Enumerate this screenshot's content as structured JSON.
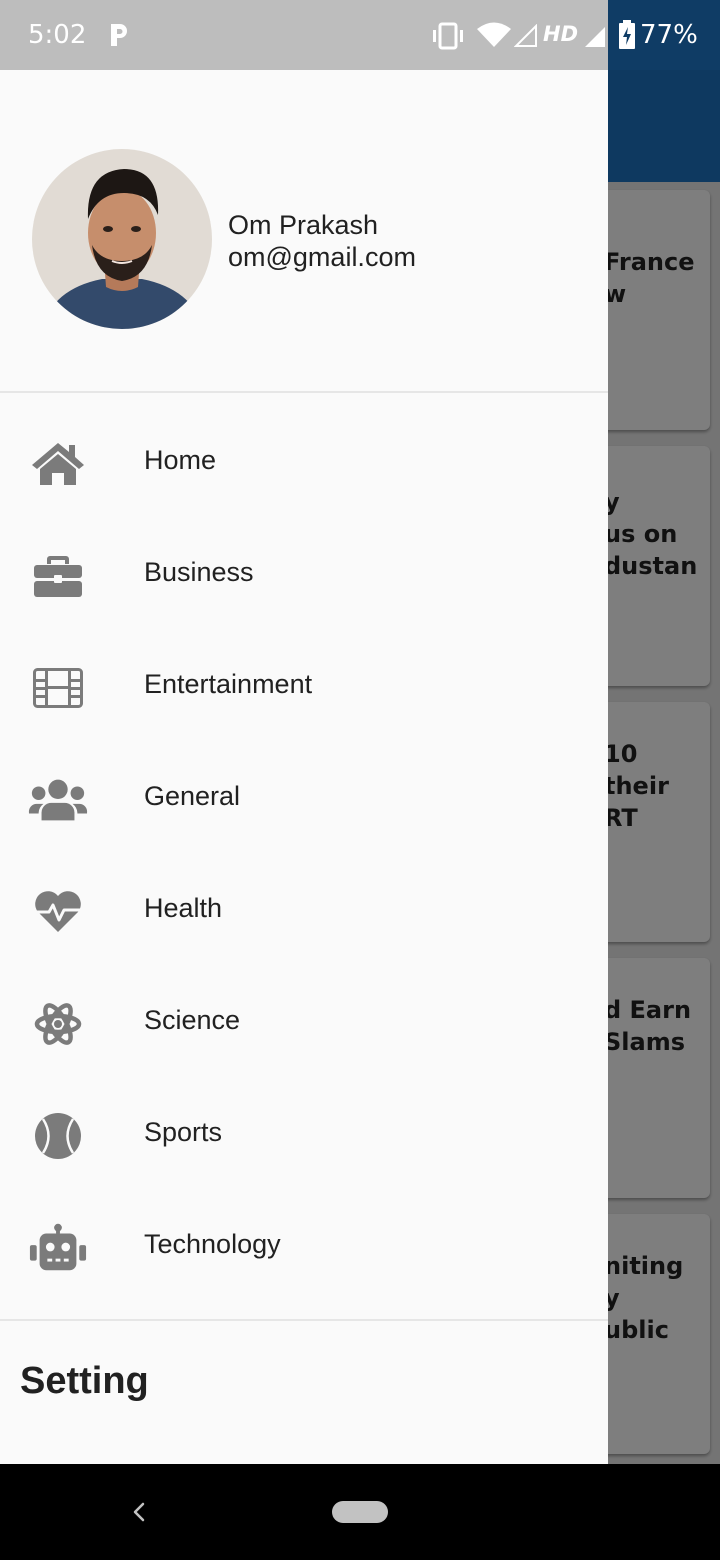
{
  "status_bar": {
    "time": "5:02",
    "network": "HD",
    "battery": "77%"
  },
  "background": {
    "cards": [
      {
        "text": "France\nw"
      },
      {
        "text": "y\nus on\ndustan"
      },
      {
        "text": "10\ntheir\nRT"
      },
      {
        "text": "d Earn\nSlams"
      },
      {
        "text": "niting\ny\nublic"
      }
    ]
  },
  "drawer": {
    "user": {
      "name": "Om Prakash",
      "email": "om@gmail.com"
    },
    "menu": [
      {
        "label": "Home",
        "icon": "home-icon"
      },
      {
        "label": "Business",
        "icon": "briefcase-icon"
      },
      {
        "label": "Entertainment",
        "icon": "film-icon"
      },
      {
        "label": "General",
        "icon": "users-icon"
      },
      {
        "label": "Health",
        "icon": "heartbeat-icon"
      },
      {
        "label": "Science",
        "icon": "atom-icon"
      },
      {
        "label": "Sports",
        "icon": "baseball-icon"
      },
      {
        "label": "Technology",
        "icon": "robot-icon"
      }
    ],
    "settings_label": "Setting"
  },
  "colors": {
    "icon_gray": "#7b7b7b",
    "text": "#212121",
    "drawer_bg": "#fafafa",
    "appbar": "#1d72c0"
  }
}
